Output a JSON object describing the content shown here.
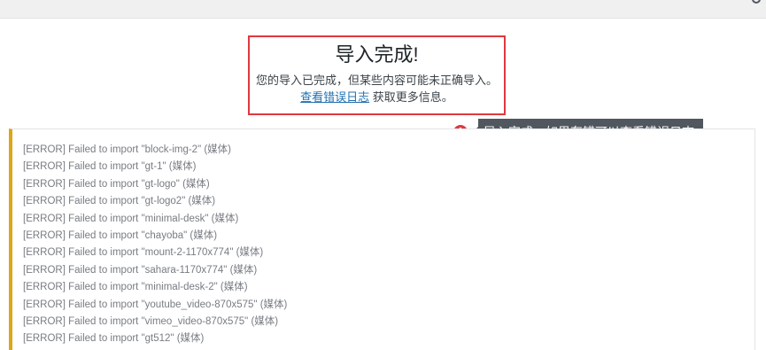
{
  "import_complete": {
    "title": "导入完成!",
    "message": "您的导入已完成，但某些内容可能未正确导入。",
    "log_link_label": "查看错误日志",
    "more_info_text": " 获取更多信息。"
  },
  "callout": {
    "badge": "1",
    "text": "导入完成，如果有错可以查看错误日志"
  },
  "error_log": {
    "lines": [
      "[ERROR] Failed to import \"block-img-2\" (媒体)",
      "[ERROR] Failed to import \"gt-1\" (媒体)",
      "[ERROR] Failed to import \"gt-logo\" (媒体)",
      "[ERROR] Failed to import \"gt-logo2\" (媒体)",
      "[ERROR] Failed to import \"minimal-desk\" (媒体)",
      "[ERROR] Failed to import \"chayoba\" (媒体)",
      "[ERROR] Failed to import \"mount-2-1170x774\" (媒体)",
      "[ERROR] Failed to import \"sahara-1170x774\" (媒体)",
      "[ERROR] Failed to import \"minimal-desk-2\" (媒体)",
      "[ERROR] Failed to import \"youtube_video-870x575\" (媒体)",
      "[ERROR] Failed to import \"vimeo_video-870x575\" (媒体)",
      "[ERROR] Failed to import \"gt512\" (媒体)"
    ]
  },
  "colors": {
    "highlight_border": "#e0393e",
    "log_accent": "#dba617",
    "link": "#2271b1",
    "callout_bg": "#50575e"
  }
}
